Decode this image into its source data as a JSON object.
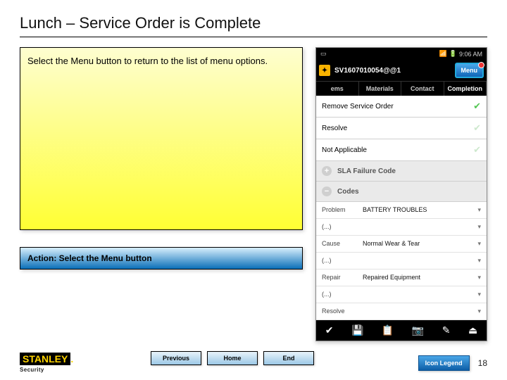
{
  "title": "Lunch – Service Order is Complete",
  "instruction": "Select the Menu button to return to the list of menu options.",
  "action": "Action:  Select the Menu button",
  "nav": {
    "prev": "Previous",
    "home": "Home",
    "end": "End"
  },
  "brand": {
    "name": "STANLEY",
    "sub": "Security"
  },
  "legend": "Icon Legend",
  "page": "18",
  "phone": {
    "time": "9:06 AM",
    "order_id": "SV1607010054@@1",
    "menu": "Menu",
    "tabs": {
      "t1": "ems",
      "t2": "Materials",
      "t3": "Contact",
      "t4": "Completion"
    },
    "rows": {
      "remove": "Remove Service Order",
      "resolve": "Resolve",
      "na": "Not Applicable"
    },
    "groups": {
      "sla": "SLA Failure Code",
      "codes": "Codes"
    },
    "kv": {
      "problem_k": "Problem",
      "problem_v": "BATTERY TROUBLES",
      "dash1": "(...)",
      "cause_k": "Cause",
      "cause_v": "Normal Wear & Tear",
      "dash2": "(...)",
      "repair_k": "Repair",
      "repair_v": "Repaired Equipment",
      "dash3": "(...)",
      "resolve_k": "Resolve"
    },
    "drop": "▾"
  }
}
